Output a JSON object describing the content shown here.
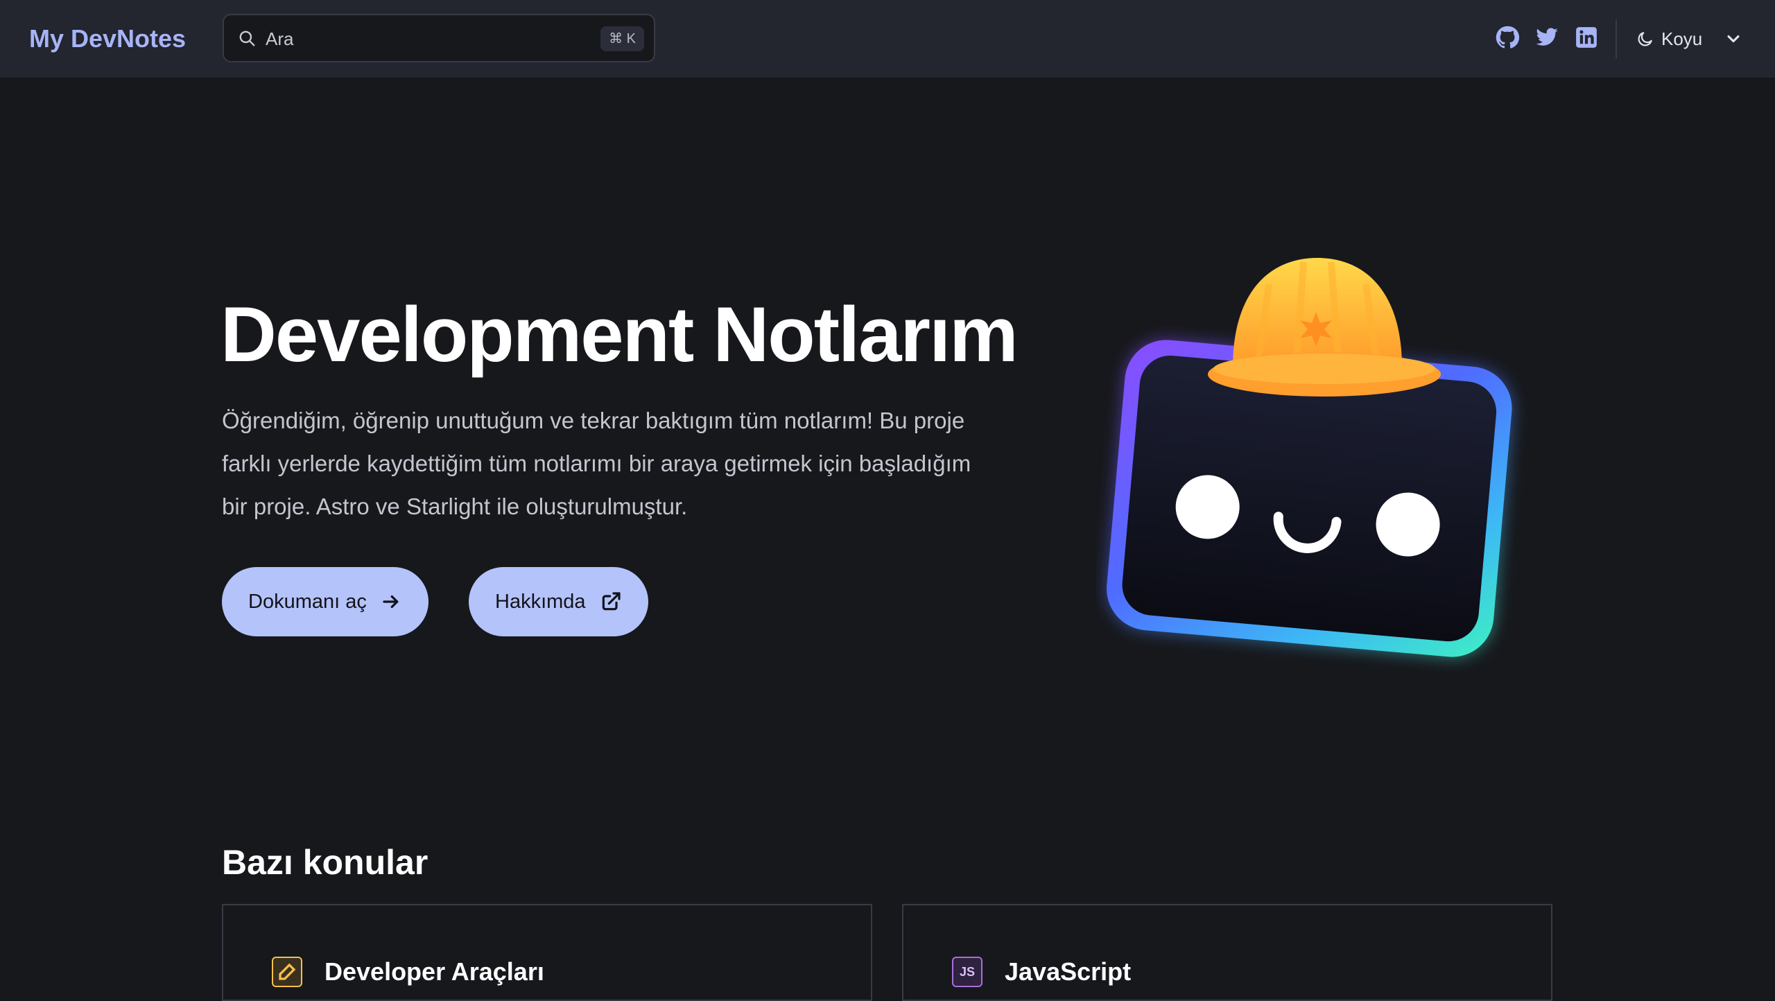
{
  "header": {
    "site_title": "My DevNotes",
    "search": {
      "placeholder": "Ara",
      "shortcut": "⌘ K"
    },
    "social_links": [
      {
        "icon": "github-icon",
        "label": "GitHub"
      },
      {
        "icon": "twitter-icon",
        "label": "Twitter"
      },
      {
        "icon": "linkedin-icon",
        "label": "LinkedIn"
      }
    ],
    "theme_select": {
      "icon": "moon-icon",
      "value": "Koyu"
    }
  },
  "hero": {
    "title": "Development Notlarım",
    "tagline": "Öğrendiğim, öğrenip unuttuğum ve tekrar baktıgım tüm notlarım! Bu proje farklı yerlerde kaydettiğim tüm notlarımı bir araya getirmek için başladığım bir proje. Astro ve Starlight ile oluşturulmuştur.",
    "actions": [
      {
        "label": "Dokumanı aç",
        "icon": "arrow-right-icon"
      },
      {
        "label": "Hakkımda",
        "icon": "external-link-icon"
      }
    ],
    "image": "houston-mascot-with-hard-hat"
  },
  "topics": {
    "title": "Bazı konular",
    "cards": [
      {
        "title": "Developer Araçları",
        "icon": "pencil-icon",
        "color": "#f5c04a"
      },
      {
        "title": "JavaScript",
        "icon": "js-icon",
        "icon_text": "JS",
        "color": "#a76fd9"
      }
    ]
  },
  "colors": {
    "accent": "#b4c3fa",
    "site_title": "#a7b4f5",
    "background": "#17181c",
    "header_background": "#23252f"
  }
}
